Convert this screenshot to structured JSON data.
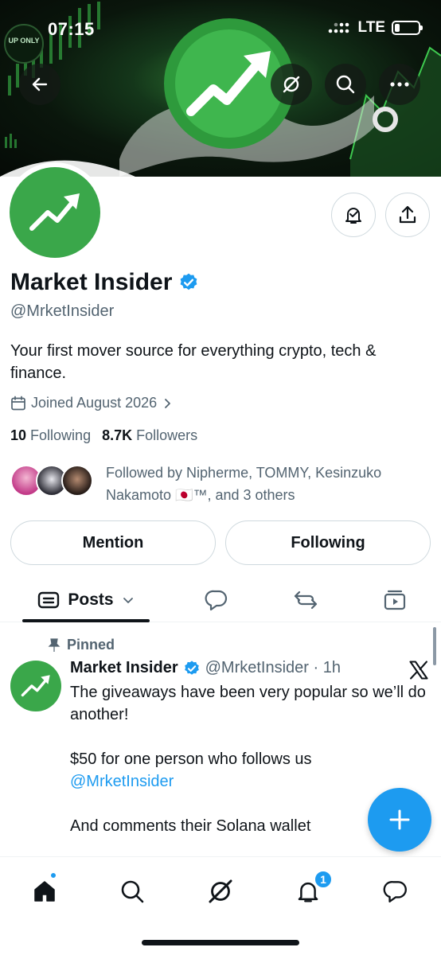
{
  "status_bar": {
    "time": "07:15",
    "network": "LTE"
  },
  "banner": {
    "tag": "UP ONLY"
  },
  "profile": {
    "name": "Market Insider",
    "handle": "@MrketInsider",
    "bio": "Your first mover source for everything crypto, tech & finance.",
    "joined": "Joined August 2026",
    "following_count": "10",
    "following_label": "Following",
    "followers_count": "8.7K",
    "followers_label": "Followers",
    "followed_by": "Followed by Nipherme, TOMMY, Kesinzuko Nakamoto 🇯🇵™, and 3 others"
  },
  "buttons": {
    "mention": "Mention",
    "following": "Following"
  },
  "tabs": {
    "posts": "Posts"
  },
  "post": {
    "pinned_label": "Pinned",
    "author": "Market Insider",
    "meta": "@MrketInsider · 1h",
    "line1": "The giveaways have been very popular so we’ll do another!",
    "line2": "$50 for one person who follows us",
    "mention": "@MrketInsider",
    "line3": "And comments their Solana wallet"
  },
  "nav": {
    "notifications_badge": "1"
  },
  "colors": {
    "accent": "#1d9bf0",
    "brand_green": "#3aa74a",
    "text": "#0f1419",
    "muted": "#536471"
  },
  "icons": [
    "back-arrow-icon",
    "grok-icon",
    "search-icon",
    "more-icon",
    "bell-icon",
    "share-icon",
    "calendar-icon",
    "chevron-right-icon",
    "verified-icon",
    "posts-icon",
    "chevron-down-icon",
    "reply-icon",
    "repost-icon",
    "video-icon",
    "pin-icon",
    "x-logo-icon",
    "plus-icon",
    "home-icon"
  ]
}
